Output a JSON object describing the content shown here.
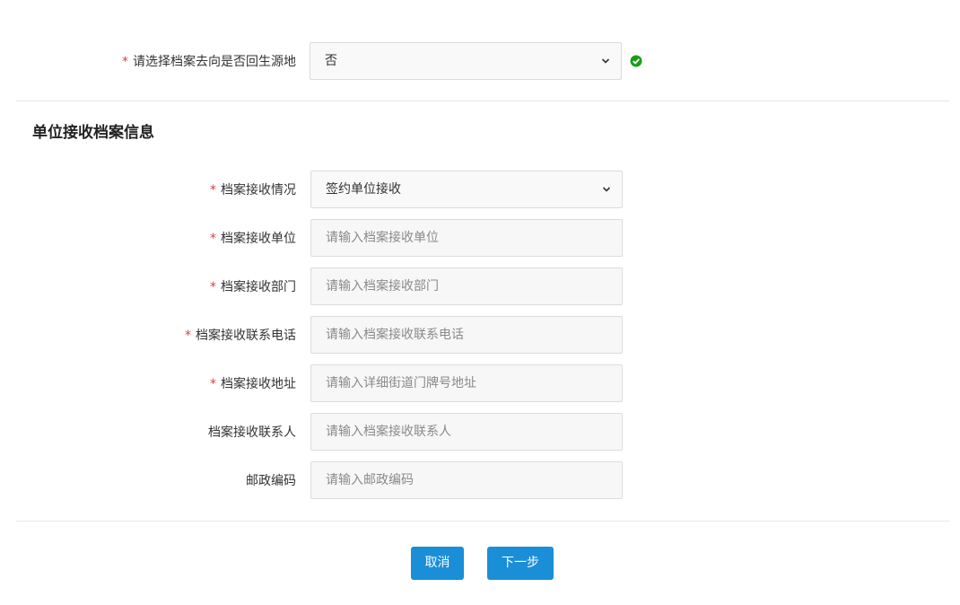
{
  "origin_question": {
    "label": "请选择档案去向是否回生源地",
    "required_mark": "*",
    "value": "否",
    "icon": "check-circle-icon",
    "status_color": "#1a9e1a"
  },
  "section": {
    "title": "单位接收档案信息"
  },
  "fields": {
    "receive_status": {
      "label": "档案接收情况",
      "required_mark": "*",
      "value": "签约单位接收"
    },
    "receive_unit": {
      "label": "档案接收单位",
      "required_mark": "*",
      "placeholder": "请输入档案接收单位"
    },
    "receive_dept": {
      "label": "档案接收部门",
      "required_mark": "*",
      "placeholder": "请输入档案接收部门"
    },
    "receive_phone": {
      "label": "档案接收联系电话",
      "required_mark": "*",
      "placeholder": "请输入档案接收联系电话"
    },
    "receive_address": {
      "label": "档案接收地址",
      "required_mark": "*",
      "placeholder": "请输入详细街道门牌号地址"
    },
    "receive_contact": {
      "label": "档案接收联系人",
      "placeholder": "请输入档案接收联系人"
    },
    "postal_code": {
      "label": "邮政编码",
      "placeholder": "请输入邮政编码"
    }
  },
  "actions": {
    "cancel_label": "取消",
    "next_label": "下一步",
    "button_color": "#1a8fd8"
  },
  "colors": {
    "required": "#e4393c",
    "border": "#dcdcdc",
    "input_bg": "#f7f7f7"
  }
}
